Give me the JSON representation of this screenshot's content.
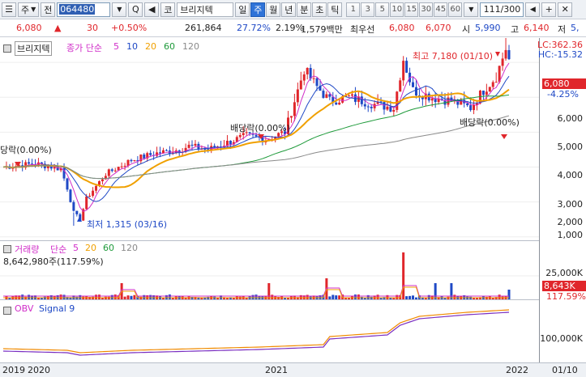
{
  "toolbar": {
    "market": "주",
    "jeon": "전",
    "code": "064480",
    "search_glyph": "Q",
    "sound_glyph": "◀",
    "kosdaq": "코",
    "stock_name": "브리지텍",
    "periods": [
      {
        "label": "일",
        "selected": false
      },
      {
        "label": "주",
        "selected": true
      },
      {
        "label": "월",
        "selected": false
      },
      {
        "label": "년",
        "selected": false
      },
      {
        "label": "분",
        "selected": false
      },
      {
        "label": "초",
        "selected": false
      },
      {
        "label": "틱",
        "selected": false
      }
    ],
    "intervals": [
      "1",
      "3",
      "5",
      "10",
      "15",
      "30",
      "45",
      "60"
    ],
    "count": "111/300"
  },
  "quote": {
    "price": "6,080",
    "change": "30",
    "change_pct": "+0.50%",
    "volume": "261,864",
    "turnover": "27.72%",
    "volume_pct": "2.19%",
    "amount": "1,579백만",
    "best_ask_label": "최우선",
    "best_ask": "6,080",
    "best_bid": "6,070",
    "open_label": "시",
    "open": "5,990",
    "high_label": "고",
    "high": "6,140",
    "low_label": "저",
    "low": "5,"
  },
  "price_panel": {
    "stock_label": "브리지텍",
    "ma_label": "종가 단순",
    "ma_periods": [
      {
        "label": "5",
        "color": "#d12fc9"
      },
      {
        "label": "10",
        "color": "#1f49c6"
      },
      {
        "label": "20",
        "color": "#f0a000"
      },
      {
        "label": "60",
        "color": "#1e9a3a"
      },
      {
        "label": "120",
        "color": "#8a8a8a"
      }
    ],
    "lc": "LC:362.36",
    "hc": "HC:-15.32",
    "current_price_tag": "6,080",
    "current_pct": "-4.25%",
    "high_annotation": "최고 7,180 (01/10)",
    "low_annotation": "최저 1,315 (03/16)",
    "dividend_annotations": [
      "당락(0.00%)",
      "배당락(0.00%)",
      "배당락(0.00%)"
    ],
    "yaxis": [
      "6,000",
      "5,000",
      "4,000",
      "3,000",
      "2,000",
      "1,000"
    ]
  },
  "volume_panel": {
    "label": "거래량",
    "ma_label": "단순",
    "ma_periods": [
      {
        "label": "5",
        "color": "#d12fc9"
      },
      {
        "label": "20",
        "color": "#f0a000"
      },
      {
        "label": "60",
        "color": "#1e9a3a"
      },
      {
        "label": "120",
        "color": "#8a8a8a"
      }
    ],
    "value_line": "8,642,980주(117.59%)",
    "yaxis": [
      "25,000K"
    ],
    "current_tag": "8,643K",
    "current_pct": "117.59%"
  },
  "obv_panel": {
    "label": "OBV",
    "signal_label": "Signal 9",
    "yaxis": [
      "100,000K"
    ]
  },
  "xaxis": {
    "labels": [
      "2019",
      "2020",
      "2021",
      "2022",
      "01/10"
    ]
  },
  "chart_data": {
    "type": "candlestick",
    "timeframe": "weekly",
    "series": [
      {
        "name": "Price",
        "high": 7180,
        "high_date": "01/10",
        "low": 1315,
        "low_date": "03/16",
        "last": 6080
      }
    ],
    "ylim": [
      900,
      6700
    ],
    "volume_last": 8642980
  }
}
